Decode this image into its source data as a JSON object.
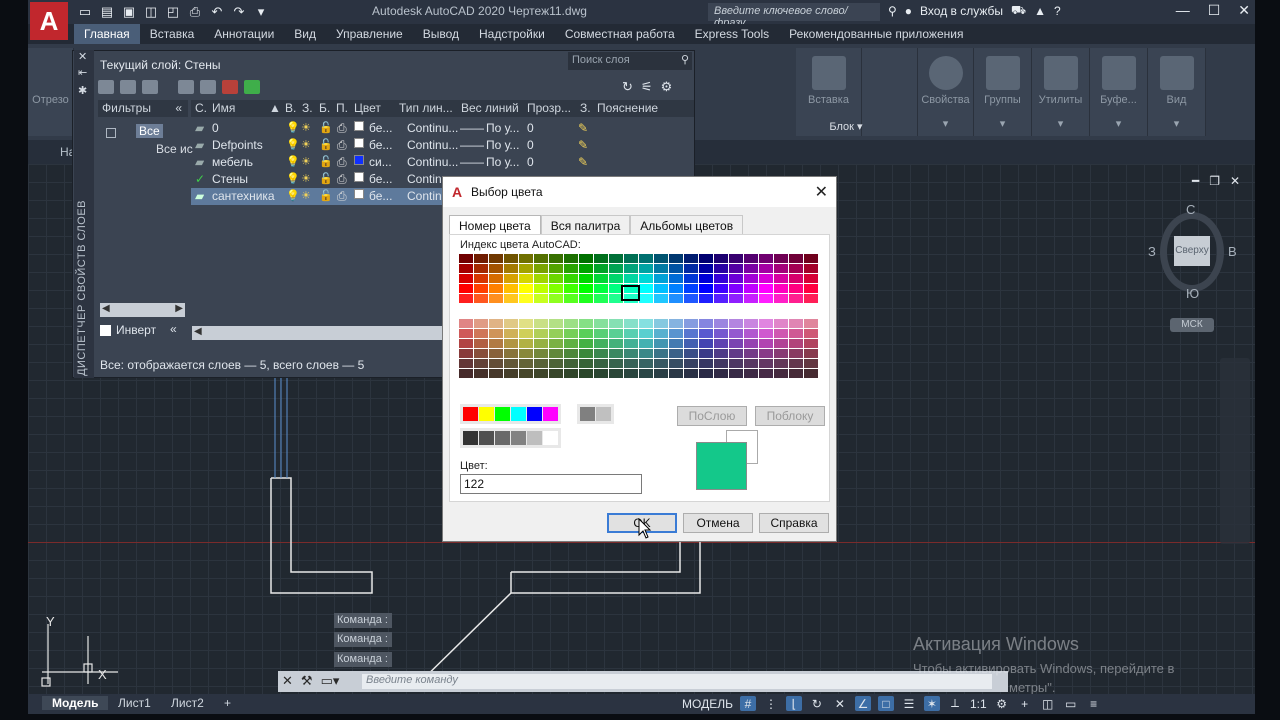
{
  "app": {
    "title": "Autodesk AutoCAD 2020   Чертеж11.dwg",
    "logo_letter": "A",
    "search_placeholder": "Введите ключевое слово/фразу",
    "signin": "Вход в службы",
    "colors": {
      "accent": "#c1272d",
      "selected_color": "#14c88a"
    }
  },
  "ribbon": {
    "tabs": [
      "Главная",
      "Вставка",
      "Аннотации",
      "Вид",
      "Управление",
      "Вывод",
      "Надстройки",
      "Совместная работа",
      "Express Tools",
      "Рекомендованные приложения"
    ],
    "groups": {
      "insert": "Вставка",
      "props": "Свойства",
      "groups": "Группы",
      "utils": "Утилиты",
      "clipboard": "Буфе...",
      "view": "Вид",
      "block": "Блок",
      "cut": "Отрезо"
    },
    "doc_tab_fragment": "На"
  },
  "layers": {
    "current": "Текущий слой: Стены",
    "search_placeholder": "Поиск слоя",
    "sidebar_title": "ДИСПЕТЧЕР СВОЙСТВ СЛОЕВ",
    "filters_header": "Фильтры",
    "filter_all": "Все",
    "filter_used": "Все ис",
    "invert": "Инверт",
    "status": "Все: отображается слоев — 5, всего слоев — 5",
    "columns": [
      "С.",
      "Имя",
      "В.",
      "З.",
      "Б.",
      "П.",
      "Цвет",
      "Тип лин...",
      "Вес линий",
      "Прозр...",
      "З.",
      "Пояснение"
    ],
    "rows": [
      {
        "name": "0",
        "color": "бе...",
        "swatch": "#ffffff",
        "linetype": "Continu...",
        "weight": "По у...",
        "transp": "0"
      },
      {
        "name": "Defpoints",
        "color": "бе...",
        "swatch": "#ffffff",
        "linetype": "Continu...",
        "weight": "По у...",
        "transp": "0"
      },
      {
        "name": "мебель",
        "color": "си...",
        "swatch": "#1030ff",
        "linetype": "Continu...",
        "weight": "По у...",
        "transp": "0"
      },
      {
        "name": "Стены",
        "color": "бе...",
        "swatch": "#ffffff",
        "linetype": "Continu",
        "weight": "",
        "transp": ""
      },
      {
        "name": "сантехника",
        "color": "бе...",
        "swatch": "#ffffff",
        "linetype": "Continu",
        "weight": "",
        "transp": ""
      }
    ]
  },
  "color_dialog": {
    "title": "Выбор цвета",
    "tabs": [
      "Номер цвета",
      "Вся палитра",
      "Альбомы цветов"
    ],
    "aci_label": "Индекс цвета AutoCAD:",
    "bylayer": "ПоСлою",
    "byblock": "Поблоку",
    "color_label": "Цвет:",
    "color_value": "122",
    "ok": "OK",
    "cancel": "Отмена",
    "help": "Справка"
  },
  "viewcube": {
    "north": "С",
    "south": "Ю",
    "west": "З",
    "east": "В",
    "top": "Сверху",
    "ucs": "МСК"
  },
  "command": {
    "history": [
      "Команда :",
      "Команда :",
      "Команда :"
    ],
    "placeholder": "Введите команду"
  },
  "activation": {
    "title": "Активация Windows",
    "text1": "Чтобы активировать Windows, перейдите в",
    "text2": "метры\"."
  },
  "statusbar": {
    "layouts": [
      "Модель",
      "Лист1",
      "Лист2",
      "+"
    ],
    "model": "МОДЕЛЬ",
    "scale": "1:1"
  }
}
